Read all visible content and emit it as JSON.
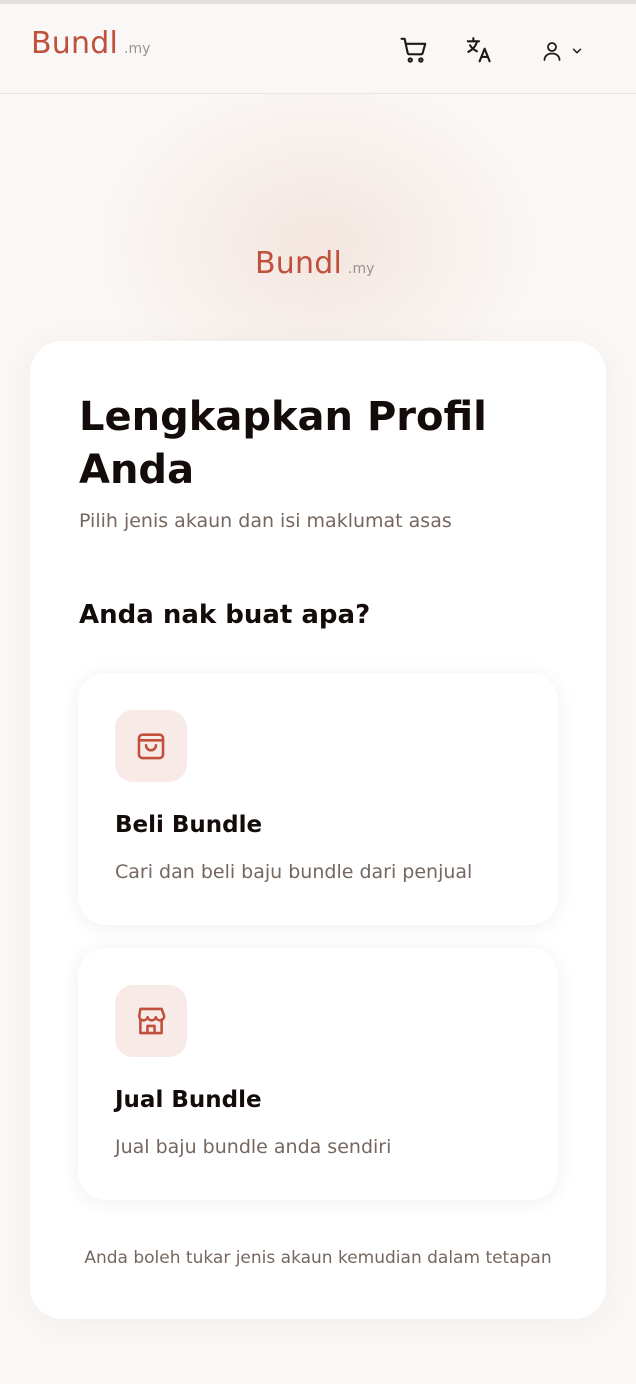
{
  "brand": {
    "name": "Bundl",
    "tld": ".my"
  },
  "header": {
    "icons": [
      "cart-icon",
      "translate-icon",
      "user-icon",
      "chevron-down-icon"
    ]
  },
  "colors": {
    "brand": "#c0503c",
    "icon_bg": "#f8ebe7",
    "page_bg": "#faf7f5",
    "muted_text": "#75675f"
  },
  "card": {
    "title": "Lengkapkan Profil Anda",
    "subtitle": "Pilih jenis akaun dan isi maklumat asas",
    "question": "Anda nak buat apa?",
    "options": [
      {
        "icon": "shopping-bag-icon",
        "title": "Beli Bundle",
        "description": "Cari dan beli baju bundle dari penjual"
      },
      {
        "icon": "store-icon",
        "title": "Jual Bundle",
        "description": "Jual baju bundle anda sendiri"
      }
    ],
    "footnote": "Anda boleh tukar jenis akaun kemudian dalam tetapan"
  }
}
